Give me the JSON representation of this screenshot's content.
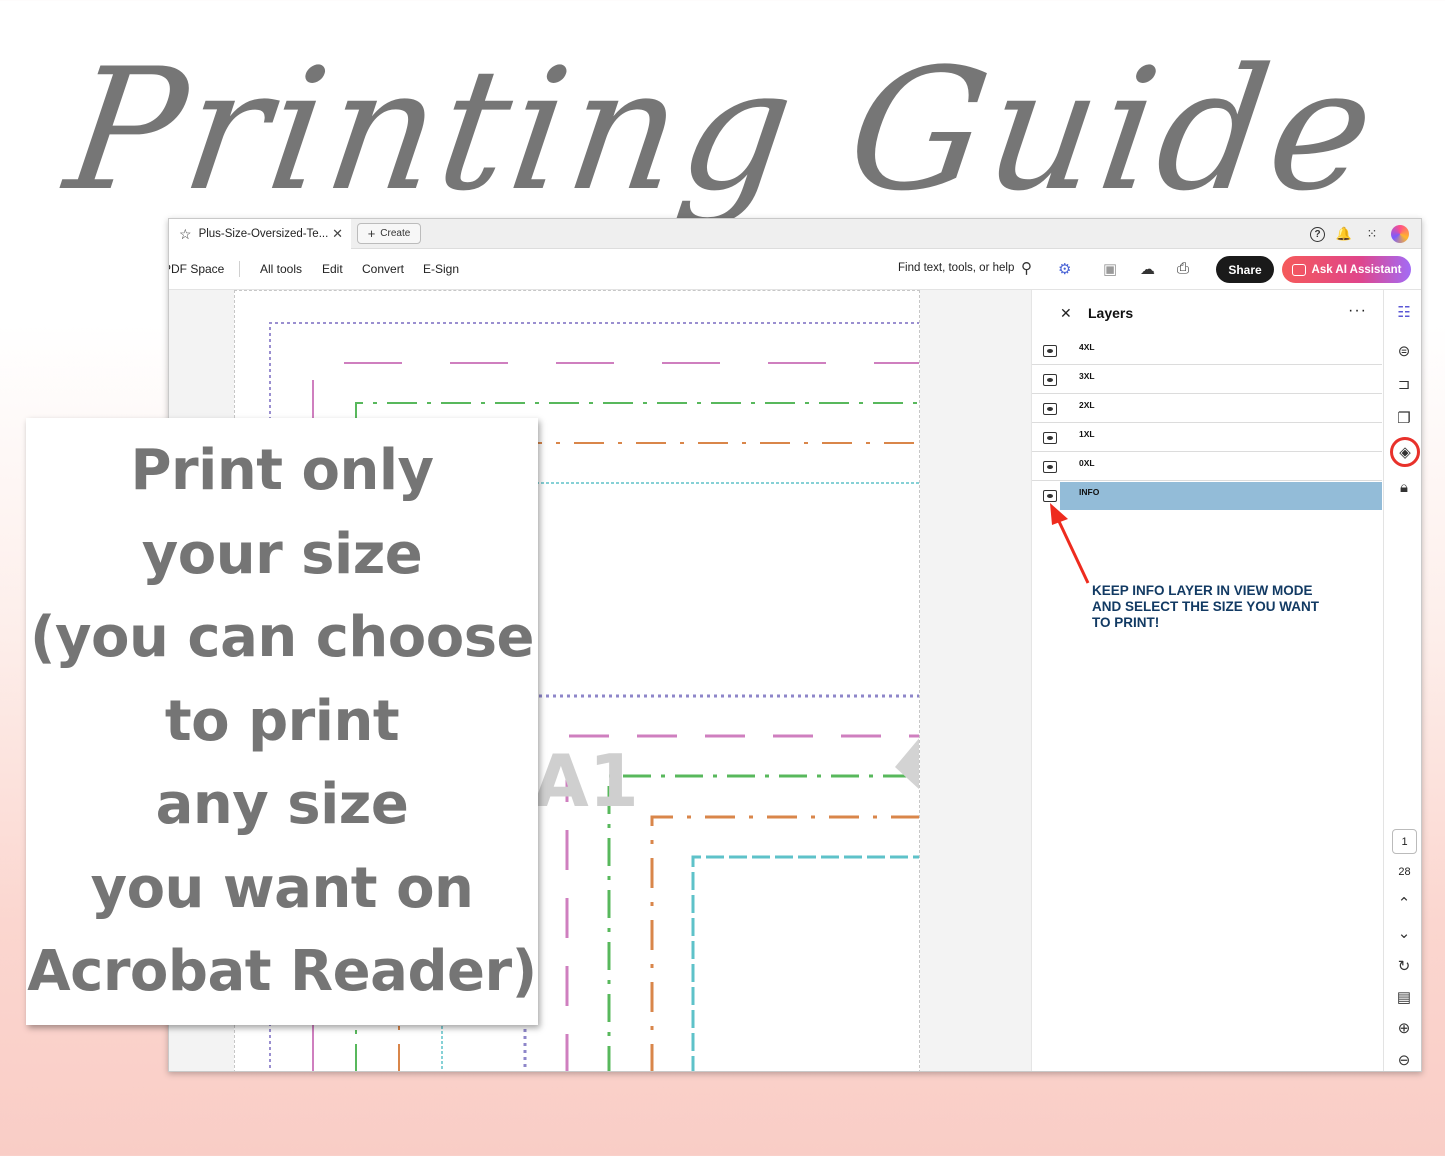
{
  "headline": "Printing Guide",
  "tab": {
    "title": "Plus-Size-Oversized-Te...",
    "create_label": "Create"
  },
  "menu": {
    "space": "PDF Space",
    "items": [
      "All tools",
      "Edit",
      "Convert",
      "E-Sign"
    ],
    "find_label": "Find text, tools, or help",
    "share_label": "Share",
    "ai_label": "Ask AI Assistant"
  },
  "layers": {
    "title": "Layers",
    "items": [
      {
        "name": "4XL",
        "selected": false
      },
      {
        "name": "3XL",
        "selected": false
      },
      {
        "name": "2XL",
        "selected": false
      },
      {
        "name": "1XL",
        "selected": false
      },
      {
        "name": "0XL",
        "selected": false
      },
      {
        "name": "INFO",
        "selected": true
      }
    ]
  },
  "annotation": {
    "lines": [
      "KEEP INFO LAYER IN VIEW MODE",
      "AND SELECT THE SIZE YOU WANT",
      "TO PRINT!"
    ]
  },
  "pagination": {
    "current": "1",
    "total": "28"
  },
  "overlay": {
    "lines": [
      "Print only",
      "your size",
      "(you can choose",
      "to print",
      "any size",
      "you want on",
      "Acrobat Reader)"
    ]
  },
  "page_mark": "A1",
  "colors": {
    "accent_red": "#e8312b",
    "annotation_text": "#123a63",
    "selected_layer": "#93bcd8",
    "headline_gray": "#767676"
  }
}
